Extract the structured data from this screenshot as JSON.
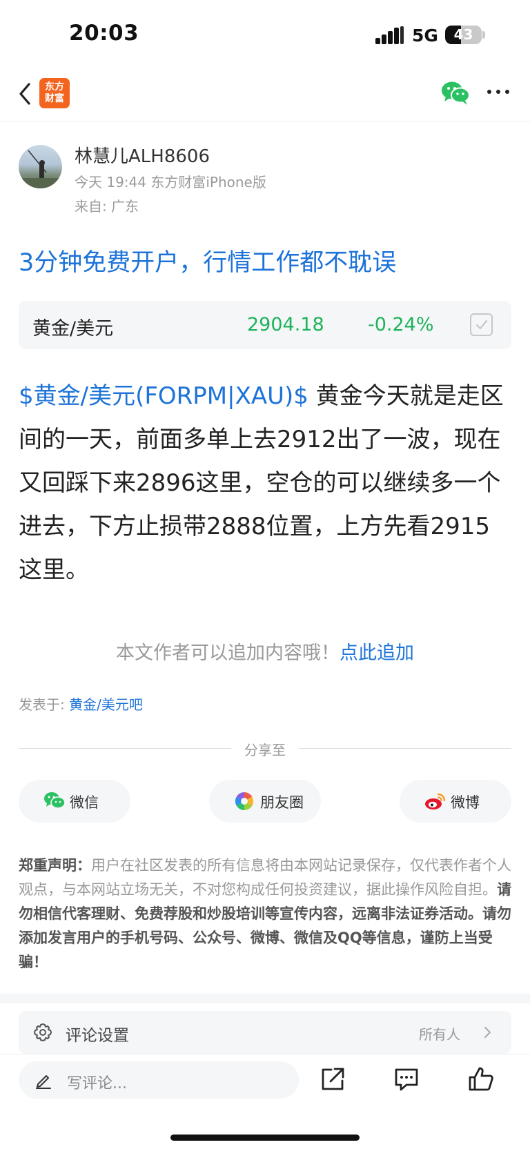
{
  "status_bar": {
    "time": "20:03",
    "network": "5G",
    "battery": "43",
    "battery_level": 0.43
  },
  "nav": {
    "logo_line1": "东方",
    "logo_line2": "财富"
  },
  "author": {
    "name": "林慧儿ALH8606",
    "meta": "今天 19:44 东方财富iPhone版",
    "location": "来自: 广东"
  },
  "promo_link": "3分钟免费开户，行情工作都不耽误",
  "quote": {
    "name": "黄金/美元",
    "price": "2904.18",
    "change": "-0.24%",
    "color": "#1db35a"
  },
  "post": {
    "stock_tag": "$黄金/美元(FORPM|XAU)$",
    "text": " 黄金今天就是走区间的一天，前面多单上去2912出了一波，现在又回踩下来2896这里，空仓的可以继续多一个进去，下方止损带2888位置，上方先看2915这里。"
  },
  "append": {
    "prompt": "本文作者可以追加内容哦！",
    "link": "点此追加"
  },
  "posted_in": {
    "label": "发表于: ",
    "forum": "黄金/美元吧"
  },
  "share": {
    "label": "分享至",
    "buttons": [
      {
        "label": "微信",
        "icon": "wechat-icon"
      },
      {
        "label": "朋友圈",
        "icon": "moments-icon"
      },
      {
        "label": "微博",
        "icon": "weibo-icon"
      }
    ]
  },
  "disclaimer": {
    "title": "郑重声明：",
    "normal": "用户在社区发表的所有信息将由本网站记录保存，仅代表作者个人观点，与本网站立场无关，不对您构成任何投资建议，据此操作风险自担。",
    "bold": "请勿相信代客理财、免费荐股和炒股培训等宣传内容，远离非法证券活动。请勿添加发言用户的手机号码、公众号、微博、微信及QQ等信息，谨防上当受骗！"
  },
  "comment_settings": {
    "label": "评论设置",
    "value": "所有人"
  },
  "bottom_bar": {
    "placeholder": "写评论..."
  },
  "colors": {
    "link": "#1d73d8",
    "brand": "#f3641f",
    "down": "#1db35a"
  }
}
